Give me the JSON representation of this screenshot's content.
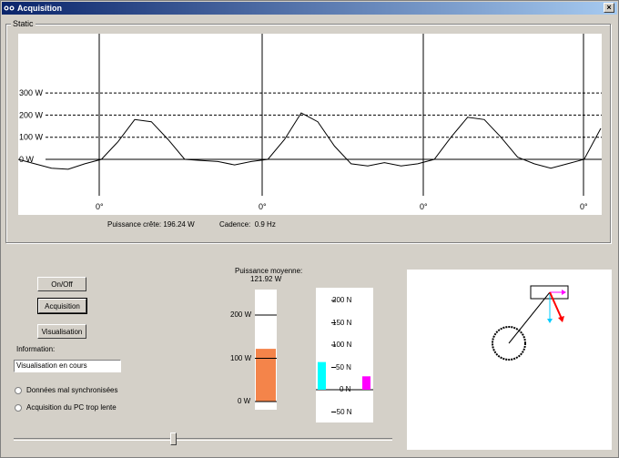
{
  "window": {
    "title": "Acquisition",
    "close_label": "×"
  },
  "group": {
    "label": "Static"
  },
  "chart_data": {
    "type": "line",
    "y_labels": [
      "300 W",
      "200 W",
      "100 W",
      "0 W"
    ],
    "y_values": [
      300,
      200,
      100,
      0
    ],
    "x_markers": [
      "0°",
      "0°",
      "0°",
      "0°"
    ],
    "series": [
      {
        "values": [
          0,
          -20,
          -40,
          -45,
          -20,
          0,
          80,
          180,
          170,
          90,
          0,
          -5,
          -10,
          -25,
          -10,
          0,
          90,
          210,
          170,
          60,
          -20,
          -30,
          -15,
          -30,
          -20,
          0,
          100,
          190,
          180,
          100,
          10,
          -20,
          -40,
          -20,
          0,
          140
        ]
      }
    ]
  },
  "stats": {
    "peak_label": "Puissance crête:",
    "peak_value": "196.24 W",
    "cadence_label": "Cadence:",
    "cadence_value": "0.9 Hz"
  },
  "controls": {
    "onoff": "On/Off",
    "acquisition": "Acquisition",
    "visualisation": "Visualisation",
    "info_label": "Information:",
    "info_value": "Visualisation en cours",
    "radio1": "Données mal synchronisées",
    "radio2": "Acquisition du PC trop lente"
  },
  "power_gauge": {
    "title": "Puissance moyenne:",
    "value_text": "121.92 W",
    "value": 121.92,
    "max": 200,
    "ticks": [
      "200 W",
      "100 W",
      "0 W"
    ],
    "fill_color": "#f4844a"
  },
  "force_gauge": {
    "ticks": [
      "200 N",
      "150 N",
      "100 N",
      "50 N",
      "0 N",
      "-50 N"
    ],
    "bar1": {
      "value": 62,
      "color": "#00ffff"
    },
    "bar2": {
      "value": 30,
      "color": "#ff00ff"
    }
  },
  "slider": {
    "value": 0.42
  }
}
